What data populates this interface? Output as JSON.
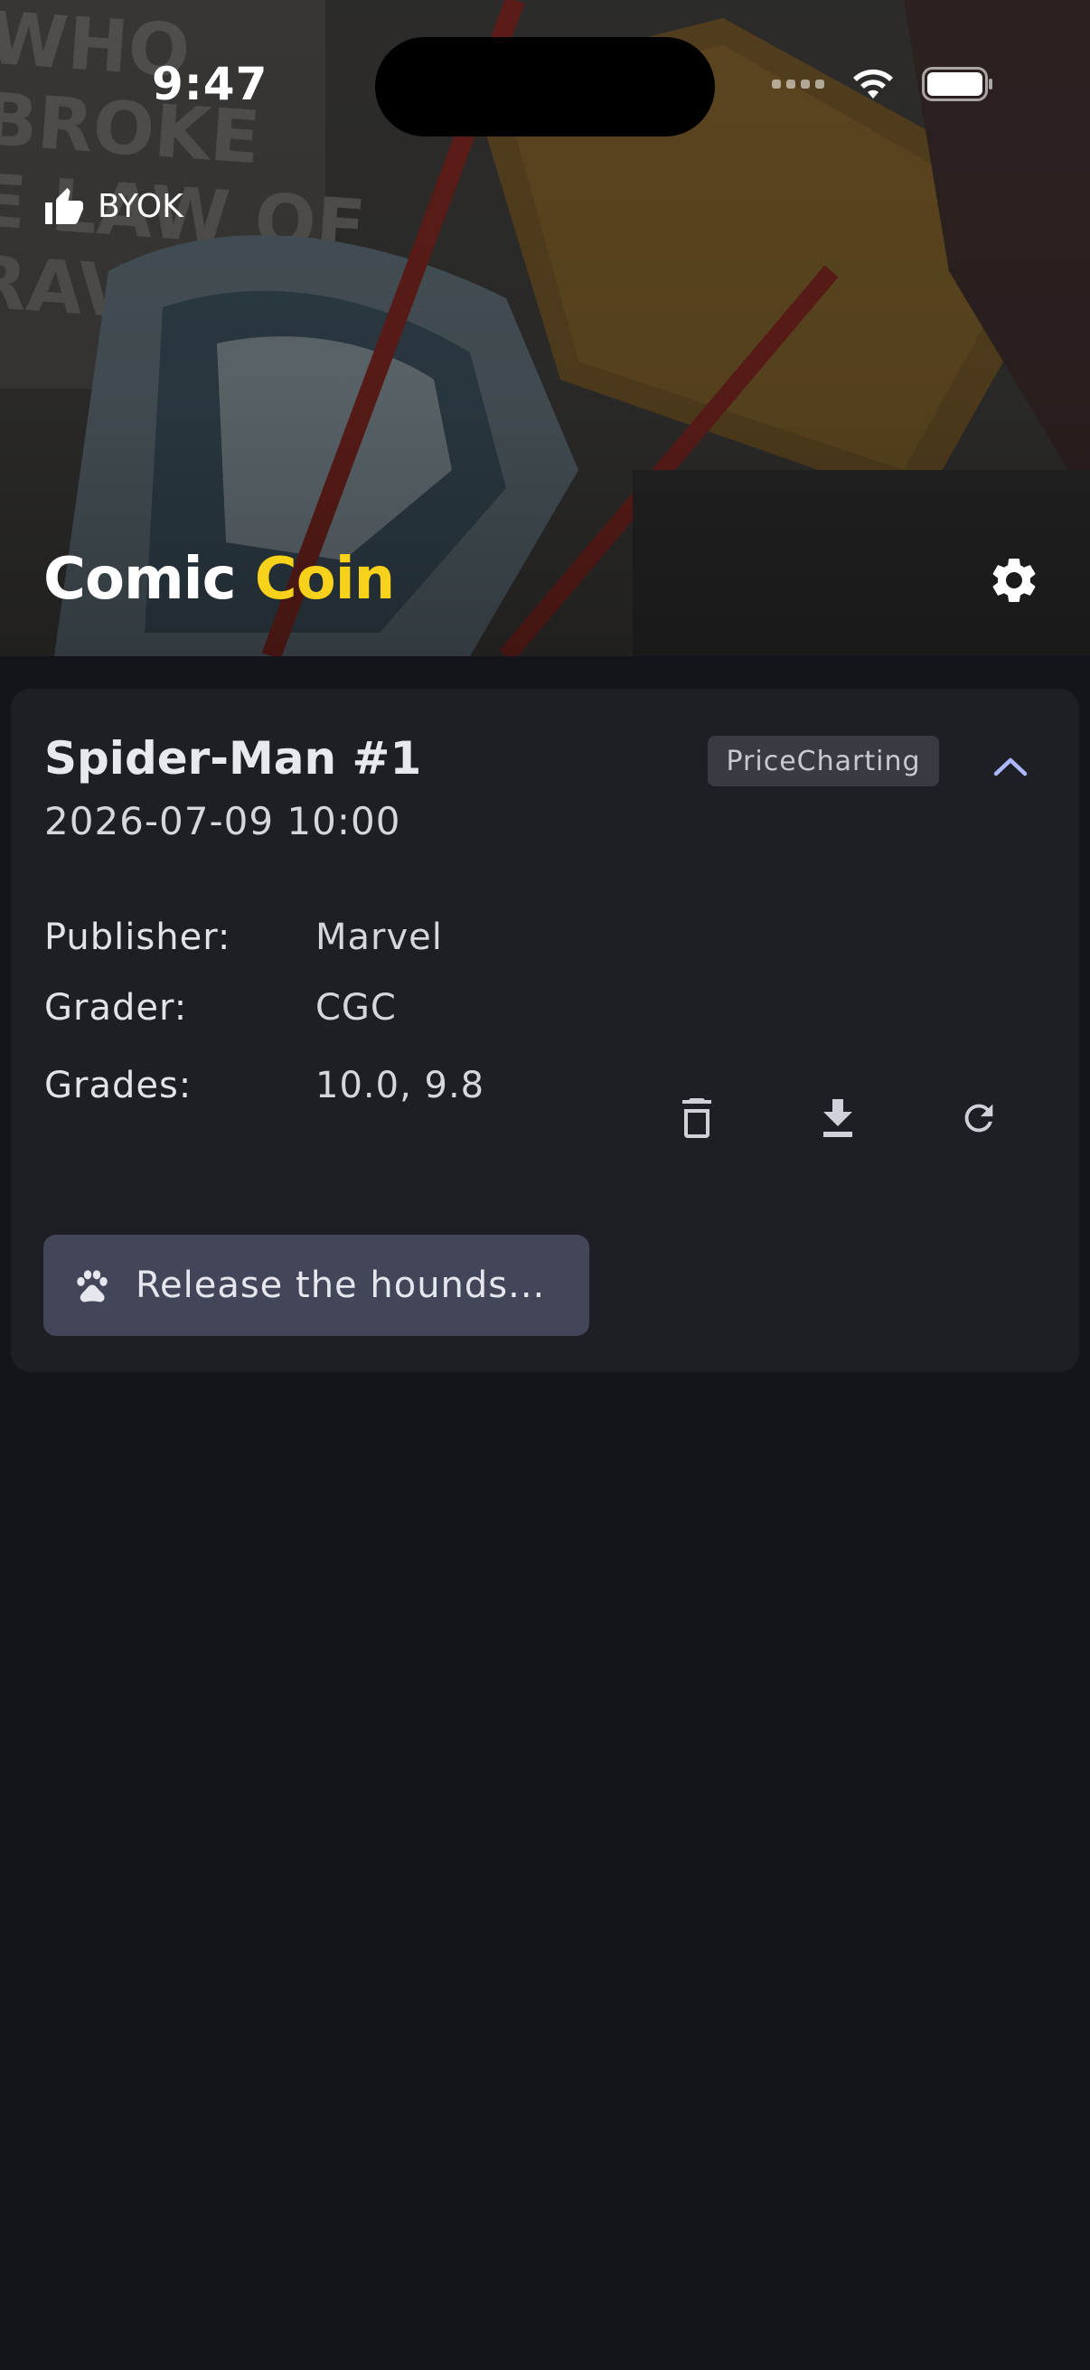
{
  "status_bar": {
    "time": "9:47"
  },
  "header": {
    "byok_label": "BYOK",
    "app_title_primary": "Comic",
    "app_title_accent": "Coin",
    "accent_color": "#f8d21a"
  },
  "card": {
    "title": "Spider-Man #1",
    "date": "2026-07-09 10:00",
    "source_badge": "PriceCharting",
    "details": [
      {
        "label": "Publisher:",
        "value": "Marvel"
      },
      {
        "label": "Grader:",
        "value": "CGC"
      },
      {
        "label": "Grades:",
        "value": "10.0, 9.8"
      }
    ],
    "actions": [
      {
        "icon": "delete-icon"
      },
      {
        "icon": "download-icon"
      },
      {
        "icon": "refresh-icon"
      }
    ],
    "primary_button_label": "Release the hounds..."
  },
  "icons": {
    "byok": "thumbs-up-icon",
    "settings": "gear-icon",
    "collapse": "chevron-up-icon",
    "hounds": "paw-icon"
  },
  "colors": {
    "background": "#14151a",
    "card": "#1e1f25",
    "button": "#434659",
    "chevron": "#aeb8ff"
  }
}
